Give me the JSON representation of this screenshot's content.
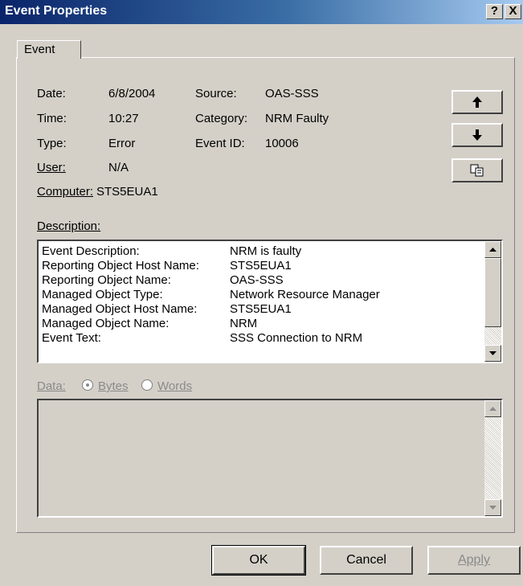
{
  "window": {
    "title": "Event Properties",
    "help_label": "?",
    "close_label": "X"
  },
  "tabs": [
    {
      "label": "Event"
    }
  ],
  "fields": {
    "date_label": "Date:",
    "date_value": "6/8/2004",
    "time_label": "Time:",
    "time_value": "10:27",
    "type_label": "Type:",
    "type_value": "Error",
    "user_label": "User:",
    "user_value": "N/A",
    "computer_label": "Computer:",
    "computer_value": "STS5EUA1",
    "source_label": "Source:",
    "source_value": "OAS-SSS",
    "category_label": "Category:",
    "category_value": "NRM Faulty",
    "eventid_label": "Event ID:",
    "eventid_value": "10006"
  },
  "side_buttons": {
    "up_icon": "arrow-up-icon",
    "down_icon": "arrow-down-icon",
    "copy_icon": "copy-icon"
  },
  "description": {
    "label": "Description:",
    "rows": [
      {
        "key": "Event Description:",
        "value": "NRM is faulty"
      },
      {
        "key": "Reporting Object Host Name:",
        "value": "STS5EUA1"
      },
      {
        "key": "Reporting Object Name:",
        "value": "OAS-SSS"
      },
      {
        "key": "Managed Object Type:",
        "value": "Network Resource Manager"
      },
      {
        "key": "Managed Object Host Name:",
        "value": "STS5EUA1"
      },
      {
        "key": "Managed Object Name:",
        "value": "NRM"
      },
      {
        "key": "Event Text:",
        "value": "SSS Connection to NRM"
      }
    ]
  },
  "data_section": {
    "label": "Data:",
    "bytes_label": "Bytes",
    "words_label": "Words",
    "selected": "Bytes"
  },
  "footer": {
    "ok_label": "OK",
    "cancel_label": "Cancel",
    "apply_label": "Apply"
  }
}
